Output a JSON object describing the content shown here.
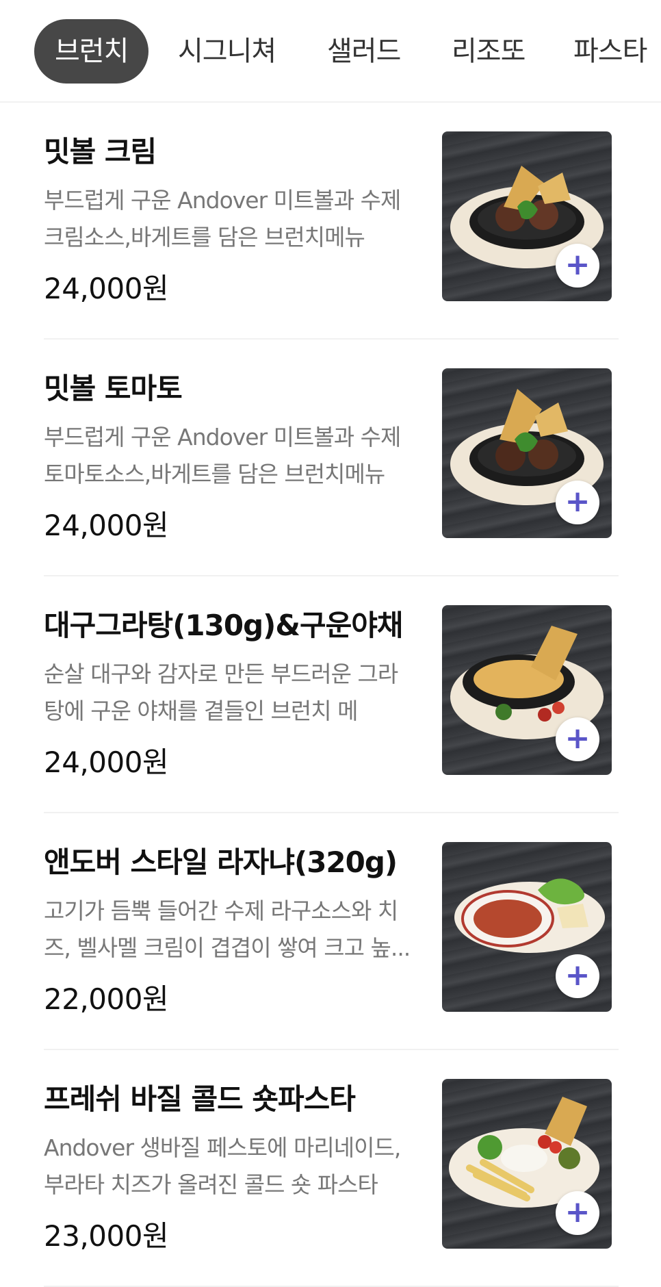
{
  "tabs": [
    "브런치",
    "시그니쳐",
    "샐러드",
    "리조또",
    "파스타"
  ],
  "add_icon": "+",
  "colors": {
    "active_tab_bg": "#474747",
    "add_icon": "#5a55c8"
  },
  "items": [
    {
      "name": "밋볼 크림",
      "desc_line1": "부드럽게 구운 Andover 미트볼과 수제",
      "desc_line2": "크림소스,바게트를 담은 브런치메뉴",
      "price": "24,000원",
      "image_icon": "meatball-cream-dish"
    },
    {
      "name": "밋볼 토마토",
      "desc_line1": "부드럽게 구운 Andover 미트볼과 수제",
      "desc_line2": "토마토소스,바게트를 담은 브런치메뉴",
      "price": "24,000원",
      "image_icon": "meatball-tomato-dish"
    },
    {
      "name": "대구그라탕(130g)&구운야채",
      "desc_line1": "순살 대구와 감자로 만든 부드러운 그라",
      "desc_line2": "탕에 구운 야채를 곁들인 브런치 메",
      "price": "24,000원",
      "image_icon": "cod-gratin-dish"
    },
    {
      "name": "앤도버 스타일 라자냐(320g)",
      "desc_line1": "고기가 듬뿍 들어간 수제 라구소스와 치",
      "desc_line2": "즈, 벨사멜 크림이 겹겹이 쌓여 크고 높...",
      "price": "22,000원",
      "image_icon": "lasagna-dish"
    },
    {
      "name": "프레쉬 바질 콜드 숏파스타",
      "desc_line1": "Andover 생바질 페스토에 마리네이드,",
      "desc_line2": "부라타 치즈가 올려진 콜드 숏 파스타",
      "price": "23,000원",
      "image_icon": "basil-pasta-dish"
    }
  ]
}
